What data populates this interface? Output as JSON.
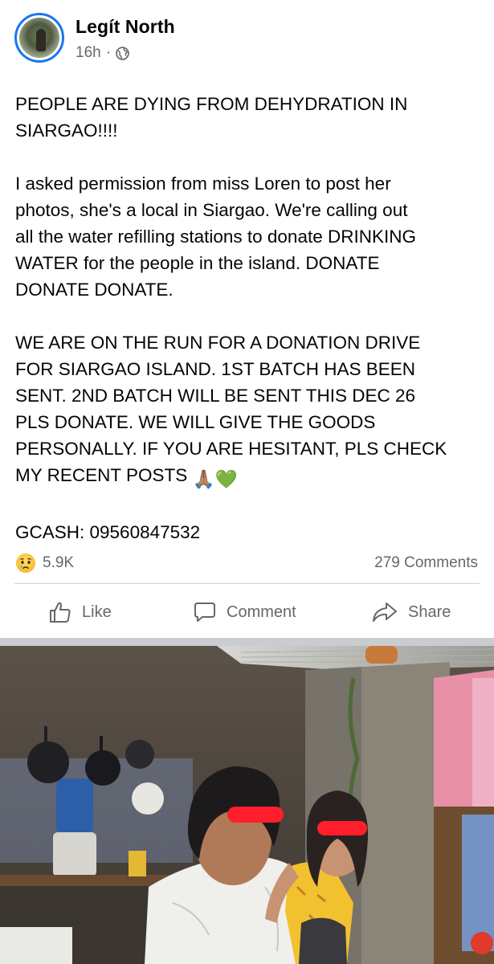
{
  "post": {
    "author": "Legít North",
    "time": "16h",
    "meta_separator": "·",
    "paragraphs": [
      "PEOPLE ARE DYING FROM DEHYDRATION IN\nSIARGAO!!!!",
      "I asked permission from miss Loren to post her\nphotos, she's a local in Siargao. We're calling out\nall the water refilling stations to donate DRINKING\nWATER for the people in the island. DONATE\nDONATE DONATE.",
      "WE ARE ON THE RUN FOR A DONATION DRIVE\nFOR SIARGAO ISLAND. 1ST BATCH HAS BEEN\nSENT. 2ND BATCH WILL BE SENT THIS DEC 26\nPLS DONATE. WE WILL GIVE THE GOODS\nPERSONALLY. IF YOU ARE HESITANT, PLS CHECK\nMY RECENT POSTS "
    ],
    "emojis": [
      "🙏🏽",
      "💚"
    ],
    "gcash": "GCASH: 09560847532"
  },
  "stats": {
    "reaction_icon": "sad-face-icon",
    "reactions_count": "5.9K",
    "comments_count": "279 Comments"
  },
  "actions": {
    "like": "Like",
    "comment": "Comment",
    "share": "Share"
  },
  "colors": {
    "accent": "#1877f2",
    "secondary_text": "#65676b",
    "divider": "#ced0d4",
    "censor_bar": "#ff1e2a"
  }
}
